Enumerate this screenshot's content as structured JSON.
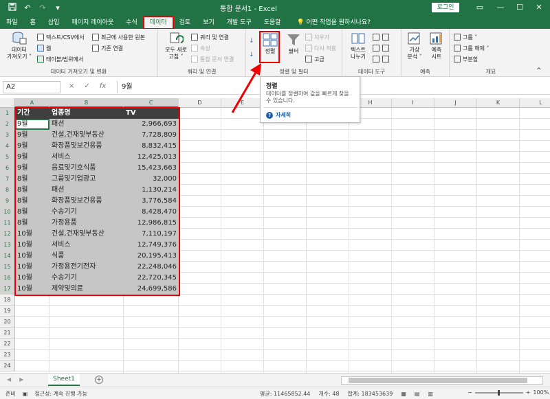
{
  "titlebar": {
    "title": "통합 문서1  -  Excel",
    "login": "로그인",
    "icons": [
      "save-icon",
      "undo-icon",
      "redo-icon",
      "customize-icon"
    ]
  },
  "tabs": [
    {
      "label": "파일"
    },
    {
      "label": "홈"
    },
    {
      "label": "삽입"
    },
    {
      "label": "페이지 레이아웃"
    },
    {
      "label": "수식"
    },
    {
      "label": "데이터"
    },
    {
      "label": "검토"
    },
    {
      "label": "보기"
    },
    {
      "label": "개발 도구"
    },
    {
      "label": "도움말"
    }
  ],
  "active_tab": "데이터",
  "tellme": "어떤 작업을 원하시나요?",
  "ribbon": {
    "get_data": {
      "label1": "데이터",
      "label2": "가져오기 ˅"
    },
    "from_text": "텍스트/CSV에서",
    "from_web": "웹",
    "from_table": "테이블/범위에서",
    "recent_sources": "최근에 사용한 원본",
    "existing_conn": "기존 연결",
    "group1_label": "데이터 가져오기 및 변환",
    "refresh_all": {
      "label1": "모두 새로",
      "label2": "고침 ˅"
    },
    "queries_conn": "쿼리 및 연결",
    "properties": "속성",
    "edit_links": "통합 문서 연결",
    "group2_label": "쿼리 및 연결",
    "sort": "정렬",
    "filter": "필터",
    "clear": "지우기",
    "reapply": "다시 적용",
    "advanced": "고급",
    "group3_label": "정렬 및 필터",
    "text_to_cols": {
      "label1": "텍스트",
      "label2": "나누기"
    },
    "group4_label": "데이터 도구",
    "whatif": {
      "label1": "가상",
      "label2": "분석 ˅"
    },
    "forecast": {
      "label1": "예측",
      "label2": "시트"
    },
    "group5_label": "예측",
    "group_btn": "그룹 ˅",
    "ungroup_btn": "그룹 해제 ˅",
    "subtotal_btn": "부분합",
    "group6_label": "개요"
  },
  "tooltip": {
    "title": "정렬",
    "desc": "데이터를 정렬하여 값을 빠르게 찾을 수 있습니다.",
    "help": "자세히"
  },
  "formula": {
    "namebox": "A2",
    "value": "9월",
    "cancel": "×",
    "enter": "✓",
    "fx": "fx"
  },
  "columns": [
    "A",
    "B",
    "C",
    "D",
    "E",
    "F",
    "G",
    "H",
    "I",
    "J",
    "K",
    "L"
  ],
  "sheet": {
    "headers": [
      "기간",
      "업종명",
      "TV"
    ],
    "rows": [
      [
        "9월",
        "패션",
        "2,966,693"
      ],
      [
        "9월",
        "건설,건재및부동산",
        "7,728,809"
      ],
      [
        "9월",
        "화장품및보건용품",
        "8,832,415"
      ],
      [
        "9월",
        "서비스",
        "12,425,013"
      ],
      [
        "9월",
        "음료및기호식품",
        "15,423,663"
      ],
      [
        "8월",
        "그룹및기업광고",
        "32,000"
      ],
      [
        "8월",
        "패션",
        "1,130,214"
      ],
      [
        "8월",
        "화장품및보건용품",
        "3,776,584"
      ],
      [
        "8월",
        "수송기기",
        "8,428,470"
      ],
      [
        "8월",
        "가정용품",
        "12,986,815"
      ],
      [
        "10월",
        "건설,건재및부동산",
        "7,110,197"
      ],
      [
        "10월",
        "서비스",
        "12,749,376"
      ],
      [
        "10월",
        "식품",
        "20,195,413"
      ],
      [
        "10월",
        "가정용전기전자",
        "22,248,046"
      ],
      [
        "10월",
        "수송기기",
        "22,720,345"
      ],
      [
        "10월",
        "제약및의료",
        "24,699,586"
      ]
    ],
    "row_numbers": [
      "1",
      "2",
      "3",
      "4",
      "5",
      "6",
      "7",
      "8",
      "9",
      "10",
      "11",
      "12",
      "13",
      "14",
      "15",
      "16",
      "17",
      "18",
      "19",
      "20",
      "21",
      "22",
      "23",
      "24"
    ]
  },
  "sheet_tabs": {
    "name": "Sheet1",
    "add": "+"
  },
  "status": {
    "ready": "준비",
    "accessibility": "접근성: 계속 진행 가능",
    "average": "평균: 11465852.44",
    "count": "개수: 48",
    "sum": "합계: 183453639",
    "zoom": "100%"
  },
  "colors": {
    "excel_green": "#217346",
    "highlight_red": "#e00000",
    "header_dark": "#3f3f3f"
  }
}
